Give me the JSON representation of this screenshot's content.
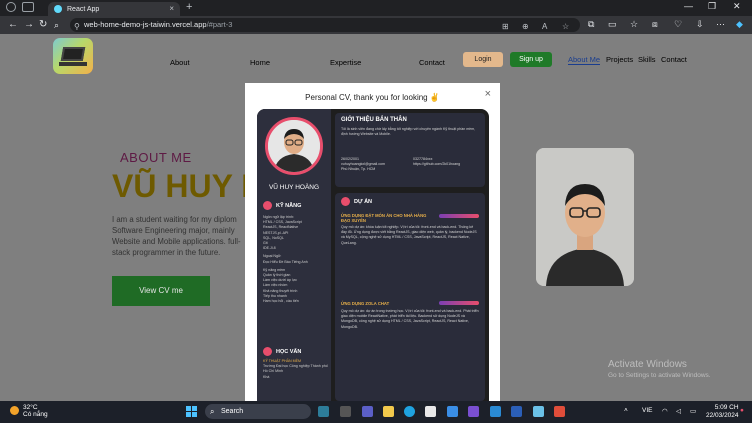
{
  "browser": {
    "tab_title": "React App",
    "tab_close": "×",
    "new_tab": "+",
    "url_host": "web-home-demo-js-taiwin.vercel.app",
    "url_path": "/#part-3",
    "window_controls": [
      "—",
      "❐",
      "✕"
    ]
  },
  "site": {
    "nav": [
      "About",
      "Home",
      "Expertise",
      "Contact"
    ],
    "login": "Login",
    "signup": "Sign up",
    "right_nav": [
      "About Me",
      "Projects",
      "Skills",
      "Contact"
    ]
  },
  "hero": {
    "about": "ABOUT ME",
    "name": "VŨ HUY H",
    "intro": "I am a student waiting for my diplom Software Engineering major, mainly Website and Mobile applications. full-stack programmer in the future.",
    "cta": "View CV me"
  },
  "modal": {
    "title": "Personal CV, thank you for looking ✌",
    "close": "×",
    "cv": {
      "name": "VŨ HUY HOÀNG",
      "skills_title": "KỸ NĂNG",
      "skills_lines": [
        "Ngôn ngữ lập trình:",
        "HTML / CSS, JavaScript",
        "ReactJS, ReactNative",
        "NESTJS,pl..API",
        "SQL, NoSQL",
        "Git",
        "IDE.Jl.8"
      ],
      "lang_title": "Ngoại Ngữ:",
      "lang_lines": [
        "Đọc Hiểu Đề Báo Tiếng Anh"
      ],
      "soft_title": "Kỹ năng mềm",
      "soft_lines": [
        "Quản lý thời gian",
        "Làm việc dưới áp lực",
        "Làm việc nhóm",
        "Khả năng thuyết trình",
        "Tiếp thu nhanh",
        "Ham học hỏi , cầu tiến"
      ],
      "edu_title": "HỌC VẤN",
      "edu_major": "KỸ THUẬT PHẦN MỀM",
      "edu_school": "Trường Đại học Công nghiệp Thành phố Hồ Chí Minh",
      "edu_note": "Khá",
      "intro_title": "GIỚI THIỆU BẢN THÂN",
      "intro_text": "Tôi là sinh viên đang chờ lấy bằng tốt nghiệp với chuyên ngành Kỹ thuật phần mềm, định hướng Website và Mobile.",
      "contact_lines": [
        "26/02/2001",
        "0327784xxx",
        "vuhuyhoangkxl@gmail.com",
        "https://github.com/2k01hoang",
        "Phú Nhuận, Tp. HCM"
      ],
      "project_title": "DỰ ÁN",
      "project1": "ỨNG DỤNG ĐẶT MÓN ĂN CHO NHÀ HÀNG ĐẠO XUYÊN",
      "project1_text": "Quy mô dự án: khóa luận tốt nghiệp. Vị trí của tôi: front-end và back-end. Thống kê đầy đủ. Ứng dụng được viết bằng ReactJS, giao diện web, quản lý, backend NodeJS và MySQL, cộng nghệ sử dụng HTML / CSS, JavaScript, ReactJS, React Native, QueLang.",
      "project2": "ỨNG DỤNG ZOLA CHAT",
      "project2_text": "Quy mô dự án: dự án trong trường học. Vị trí của tôi: front-end và back-end. Phát triển giao diện mobile ReactNative, phát triển tài liệu. Backend sử dụng NodeJS và MongoDB, công nghệ sử dụng HTML / CSS, JavaScript, ReactJS, React Native, MongoDB."
    }
  },
  "watermark": {
    "line1": "Activate Windows",
    "line2": "Go to Settings to activate Windows."
  },
  "taskbar": {
    "temp": "32°C",
    "weather": "Có nắng",
    "search": "Search",
    "lang": "VIE",
    "time": "5:09 CH",
    "date": "22/03/2024"
  },
  "colors": {
    "page_bg": "#7f7f7f",
    "accent_green": "#1f7a28",
    "login_bg": "#e3b88c",
    "name_color": "#6e5a00",
    "about_color": "#5e1a44",
    "cv_accent": "#e84e6c"
  }
}
